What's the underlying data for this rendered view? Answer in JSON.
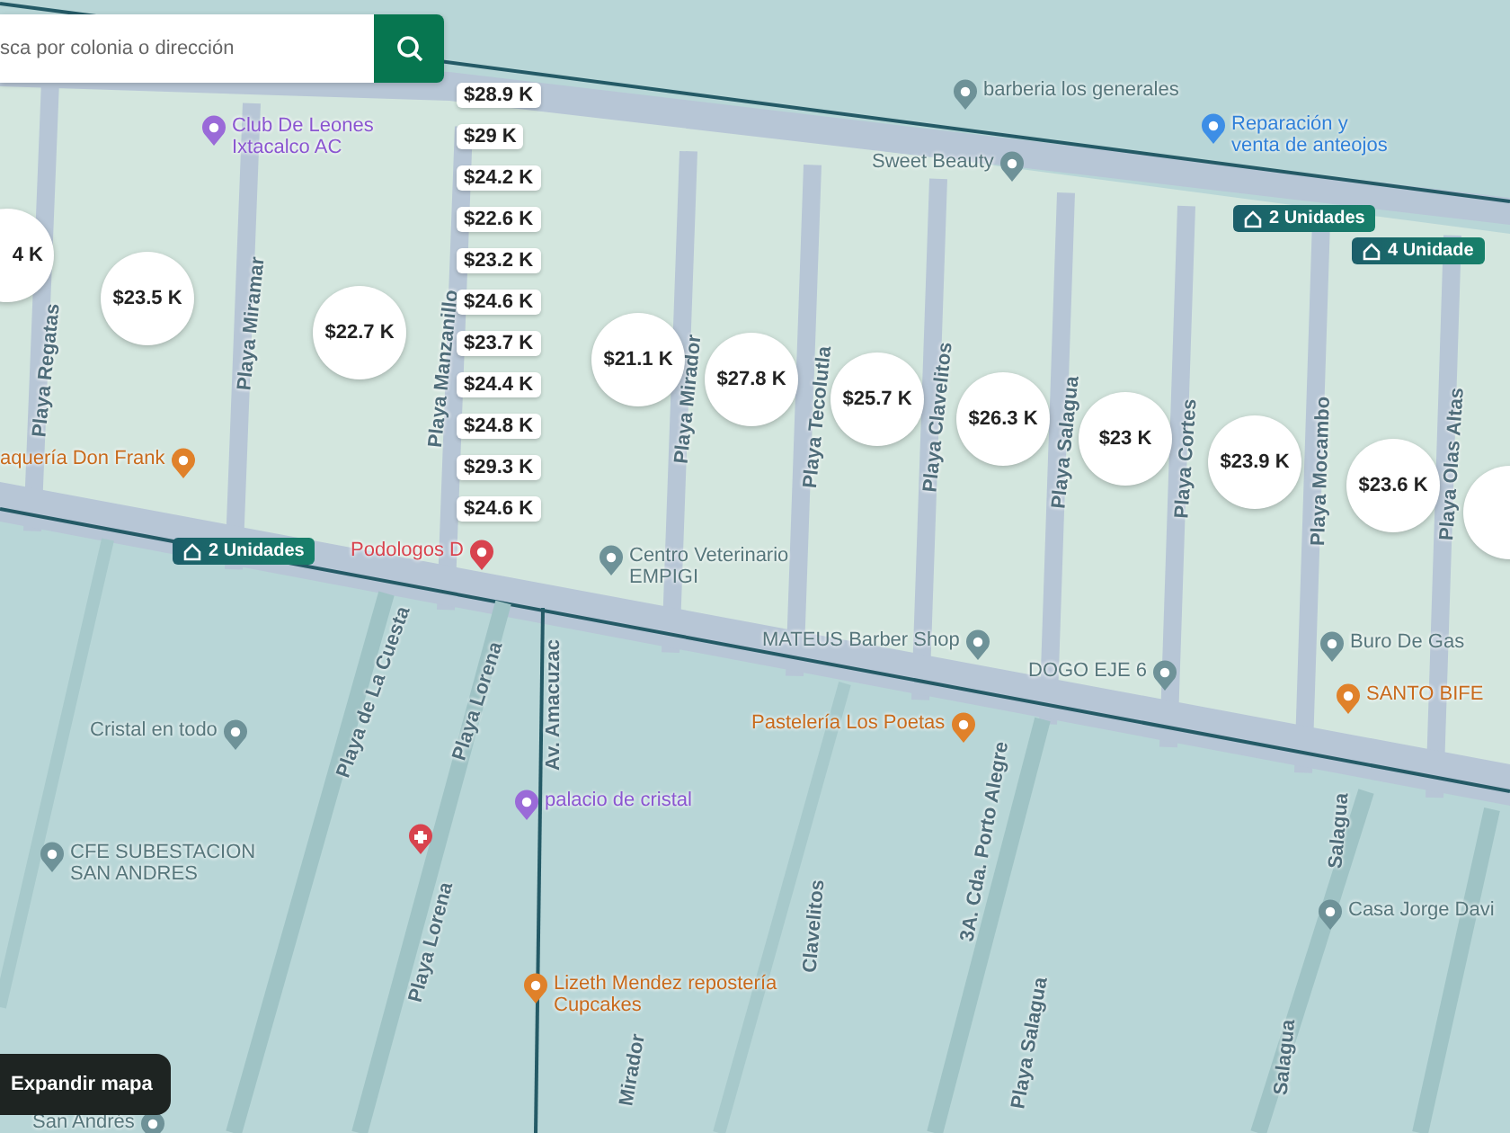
{
  "search": {
    "placeholder": "sca por colonia o dirección"
  },
  "price_cluster": [
    "$28.9 K",
    "$29 K",
    "$24.2 K",
    "$22.6 K",
    "$23.2 K",
    "$24.6 K",
    "$23.7 K",
    "$24.4 K",
    "$24.8 K",
    "$29.3 K",
    "$24.6 K"
  ],
  "price_markers": [
    "4 K",
    "$23.5 K",
    "$22.7 K",
    "$21.1 K",
    "$27.8 K",
    "$25.7 K",
    "$26.3 K",
    "$23 K",
    "$23.9 K",
    "$23.6 K"
  ],
  "unit_tags": [
    "2 Unidades",
    "4 Unidade",
    "2 Unidades"
  ],
  "street_labels": [
    "Playa Regatas",
    "Playa Miramar",
    "Playa Manzanillo",
    "Playa Mirador",
    "Playa Tecolutla",
    "Playa Clavelitos",
    "Playa Salagua",
    "Playa Cortes",
    "Playa Mocambo",
    "Playa Olas Altas",
    "Playa de La Cuesta",
    "Playa Lorena",
    "Playa Lorena",
    "Av. Amacuzac",
    "Clavelitos",
    "3A. Cda. Porto Alegre",
    "Playa Salagua",
    "Salagua",
    "Salagua",
    "Mirador"
  ],
  "places": [
    {
      "name": "Club De Leones\nIxtacalco AC",
      "kind": "landmark"
    },
    {
      "name": "barberia los generales",
      "kind": "generic"
    },
    {
      "name": "Reparación y\nventa de anteojos",
      "kind": "shopping"
    },
    {
      "name": "Sweet Beauty",
      "kind": "generic"
    },
    {
      "name": "Centro Veterinario\nEMPIGI",
      "kind": "generic"
    },
    {
      "name": "MATEUS Barber Shop",
      "kind": "generic"
    },
    {
      "name": "DOGO EJE 6",
      "kind": "generic"
    },
    {
      "name": "Buro De Gas",
      "kind": "generic"
    },
    {
      "name": "SANTO BIFE",
      "kind": "restaurant"
    },
    {
      "name": "Pastelería Los Poetas",
      "kind": "restaurant"
    },
    {
      "name": "Cristal en todo",
      "kind": "generic"
    },
    {
      "name": "CFE SUBESTACION\nSAN ANDRES",
      "kind": "generic"
    },
    {
      "name": "palacio de cristal",
      "kind": "landmark"
    },
    {
      "name": "Lizeth Mendez repostería\nCupcakes",
      "kind": "restaurant"
    },
    {
      "name": "Casa Jorge Davi",
      "kind": "generic"
    },
    {
      "name": "aquería Don Frank",
      "kind": "restaurant"
    },
    {
      "name": "Podologos D",
      "kind": "health"
    },
    {
      "name": "San Andrés",
      "kind": "generic"
    }
  ],
  "expand_button": {
    "label": "Expandir mapa"
  }
}
